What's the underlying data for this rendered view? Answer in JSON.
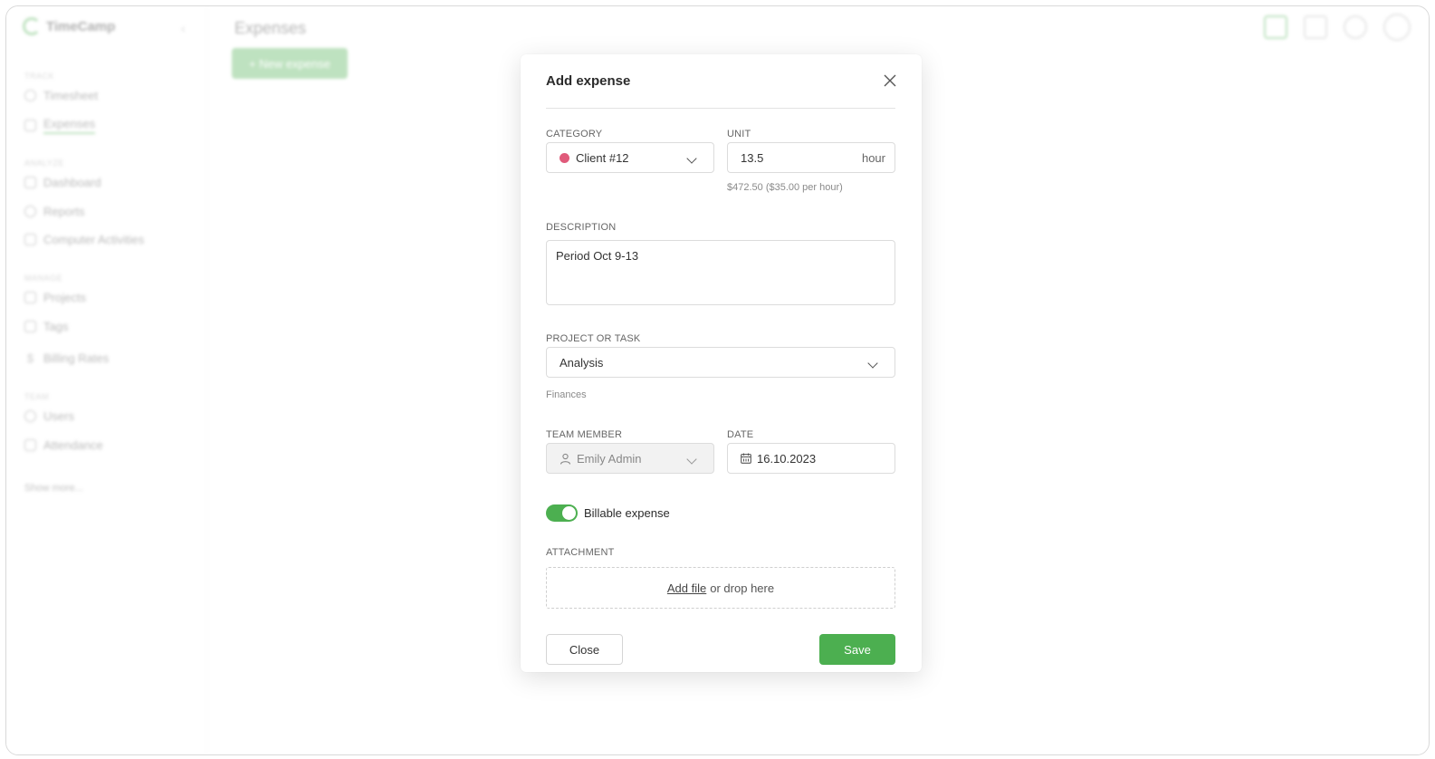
{
  "app": {
    "logo_text": "TimeCamp",
    "page_title": "Expenses",
    "new_expense_label": "+ New expense",
    "sidebar": {
      "sections": [
        {
          "title": "TRACK",
          "items": [
            {
              "label": "Timesheet",
              "icon": "clock-icon"
            },
            {
              "label": "Expenses",
              "icon": "receipt-icon",
              "active": true
            }
          ]
        },
        {
          "title": "ANALYZE",
          "items": [
            {
              "label": "Dashboard",
              "icon": "dashboard-icon"
            },
            {
              "label": "Reports",
              "icon": "pie-chart-icon"
            },
            {
              "label": "Computer Activities",
              "icon": "laptop-icon"
            }
          ]
        },
        {
          "title": "MANAGE",
          "items": [
            {
              "label": "Projects",
              "icon": "folder-icon"
            },
            {
              "label": "Tags",
              "icon": "tag-icon"
            },
            {
              "label": "Billing Rates",
              "icon": "dollar-icon"
            }
          ]
        },
        {
          "title": "TEAM",
          "items": [
            {
              "label": "Users",
              "icon": "users-icon"
            },
            {
              "label": "Attendance",
              "icon": "calendar-icon"
            }
          ]
        }
      ],
      "show_more": "Show more..."
    }
  },
  "modal": {
    "title": "Add expense",
    "category": {
      "label": "CATEGORY",
      "value": "Client #12",
      "color": "#e05a7a"
    },
    "unit": {
      "label": "UNIT",
      "value": "13.5",
      "suffix": "hour",
      "hint": "$472.50 ($35.00 per hour)"
    },
    "description": {
      "label": "DESCRIPTION",
      "value": "Period Oct 9-13"
    },
    "project": {
      "label": "PROJECT OR TASK",
      "value": "Analysis",
      "hint": "Finances"
    },
    "team_member": {
      "label": "TEAM MEMBER",
      "value": "Emily Admin"
    },
    "date": {
      "label": "DATE",
      "value": "16.10.2023"
    },
    "billable": {
      "label": "Billable expense",
      "on": true
    },
    "attachment": {
      "label": "ATTACHMENT",
      "link": "Add file",
      "text": "or drop here"
    },
    "close_label": "Close",
    "save_label": "Save"
  },
  "colors": {
    "accent": "#4caf50"
  }
}
